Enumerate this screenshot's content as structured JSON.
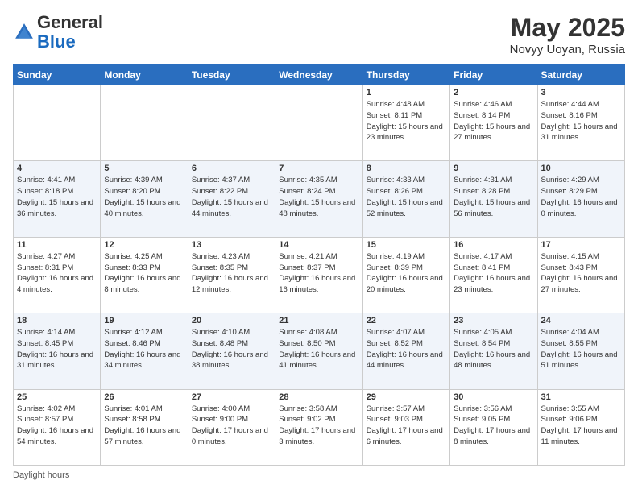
{
  "header": {
    "logo_general": "General",
    "logo_blue": "Blue",
    "title": "May 2025",
    "location": "Novyy Uoyan, Russia"
  },
  "days_of_week": [
    "Sunday",
    "Monday",
    "Tuesday",
    "Wednesday",
    "Thursday",
    "Friday",
    "Saturday"
  ],
  "weeks": [
    [
      {
        "day": "",
        "info": ""
      },
      {
        "day": "",
        "info": ""
      },
      {
        "day": "",
        "info": ""
      },
      {
        "day": "",
        "info": ""
      },
      {
        "day": "1",
        "info": "Sunrise: 4:48 AM\nSunset: 8:11 PM\nDaylight: 15 hours\nand 23 minutes."
      },
      {
        "day": "2",
        "info": "Sunrise: 4:46 AM\nSunset: 8:14 PM\nDaylight: 15 hours\nand 27 minutes."
      },
      {
        "day": "3",
        "info": "Sunrise: 4:44 AM\nSunset: 8:16 PM\nDaylight: 15 hours\nand 31 minutes."
      }
    ],
    [
      {
        "day": "4",
        "info": "Sunrise: 4:41 AM\nSunset: 8:18 PM\nDaylight: 15 hours\nand 36 minutes."
      },
      {
        "day": "5",
        "info": "Sunrise: 4:39 AM\nSunset: 8:20 PM\nDaylight: 15 hours\nand 40 minutes."
      },
      {
        "day": "6",
        "info": "Sunrise: 4:37 AM\nSunset: 8:22 PM\nDaylight: 15 hours\nand 44 minutes."
      },
      {
        "day": "7",
        "info": "Sunrise: 4:35 AM\nSunset: 8:24 PM\nDaylight: 15 hours\nand 48 minutes."
      },
      {
        "day": "8",
        "info": "Sunrise: 4:33 AM\nSunset: 8:26 PM\nDaylight: 15 hours\nand 52 minutes."
      },
      {
        "day": "9",
        "info": "Sunrise: 4:31 AM\nSunset: 8:28 PM\nDaylight: 15 hours\nand 56 minutes."
      },
      {
        "day": "10",
        "info": "Sunrise: 4:29 AM\nSunset: 8:29 PM\nDaylight: 16 hours\nand 0 minutes."
      }
    ],
    [
      {
        "day": "11",
        "info": "Sunrise: 4:27 AM\nSunset: 8:31 PM\nDaylight: 16 hours\nand 4 minutes."
      },
      {
        "day": "12",
        "info": "Sunrise: 4:25 AM\nSunset: 8:33 PM\nDaylight: 16 hours\nand 8 minutes."
      },
      {
        "day": "13",
        "info": "Sunrise: 4:23 AM\nSunset: 8:35 PM\nDaylight: 16 hours\nand 12 minutes."
      },
      {
        "day": "14",
        "info": "Sunrise: 4:21 AM\nSunset: 8:37 PM\nDaylight: 16 hours\nand 16 minutes."
      },
      {
        "day": "15",
        "info": "Sunrise: 4:19 AM\nSunset: 8:39 PM\nDaylight: 16 hours\nand 20 minutes."
      },
      {
        "day": "16",
        "info": "Sunrise: 4:17 AM\nSunset: 8:41 PM\nDaylight: 16 hours\nand 23 minutes."
      },
      {
        "day": "17",
        "info": "Sunrise: 4:15 AM\nSunset: 8:43 PM\nDaylight: 16 hours\nand 27 minutes."
      }
    ],
    [
      {
        "day": "18",
        "info": "Sunrise: 4:14 AM\nSunset: 8:45 PM\nDaylight: 16 hours\nand 31 minutes."
      },
      {
        "day": "19",
        "info": "Sunrise: 4:12 AM\nSunset: 8:46 PM\nDaylight: 16 hours\nand 34 minutes."
      },
      {
        "day": "20",
        "info": "Sunrise: 4:10 AM\nSunset: 8:48 PM\nDaylight: 16 hours\nand 38 minutes."
      },
      {
        "day": "21",
        "info": "Sunrise: 4:08 AM\nSunset: 8:50 PM\nDaylight: 16 hours\nand 41 minutes."
      },
      {
        "day": "22",
        "info": "Sunrise: 4:07 AM\nSunset: 8:52 PM\nDaylight: 16 hours\nand 44 minutes."
      },
      {
        "day": "23",
        "info": "Sunrise: 4:05 AM\nSunset: 8:54 PM\nDaylight: 16 hours\nand 48 minutes."
      },
      {
        "day": "24",
        "info": "Sunrise: 4:04 AM\nSunset: 8:55 PM\nDaylight: 16 hours\nand 51 minutes."
      }
    ],
    [
      {
        "day": "25",
        "info": "Sunrise: 4:02 AM\nSunset: 8:57 PM\nDaylight: 16 hours\nand 54 minutes."
      },
      {
        "day": "26",
        "info": "Sunrise: 4:01 AM\nSunset: 8:58 PM\nDaylight: 16 hours\nand 57 minutes."
      },
      {
        "day": "27",
        "info": "Sunrise: 4:00 AM\nSunset: 9:00 PM\nDaylight: 17 hours\nand 0 minutes."
      },
      {
        "day": "28",
        "info": "Sunrise: 3:58 AM\nSunset: 9:02 PM\nDaylight: 17 hours\nand 3 minutes."
      },
      {
        "day": "29",
        "info": "Sunrise: 3:57 AM\nSunset: 9:03 PM\nDaylight: 17 hours\nand 6 minutes."
      },
      {
        "day": "30",
        "info": "Sunrise: 3:56 AM\nSunset: 9:05 PM\nDaylight: 17 hours\nand 8 minutes."
      },
      {
        "day": "31",
        "info": "Sunrise: 3:55 AM\nSunset: 9:06 PM\nDaylight: 17 hours\nand 11 minutes."
      }
    ]
  ],
  "footer": {
    "label": "Daylight hours"
  }
}
